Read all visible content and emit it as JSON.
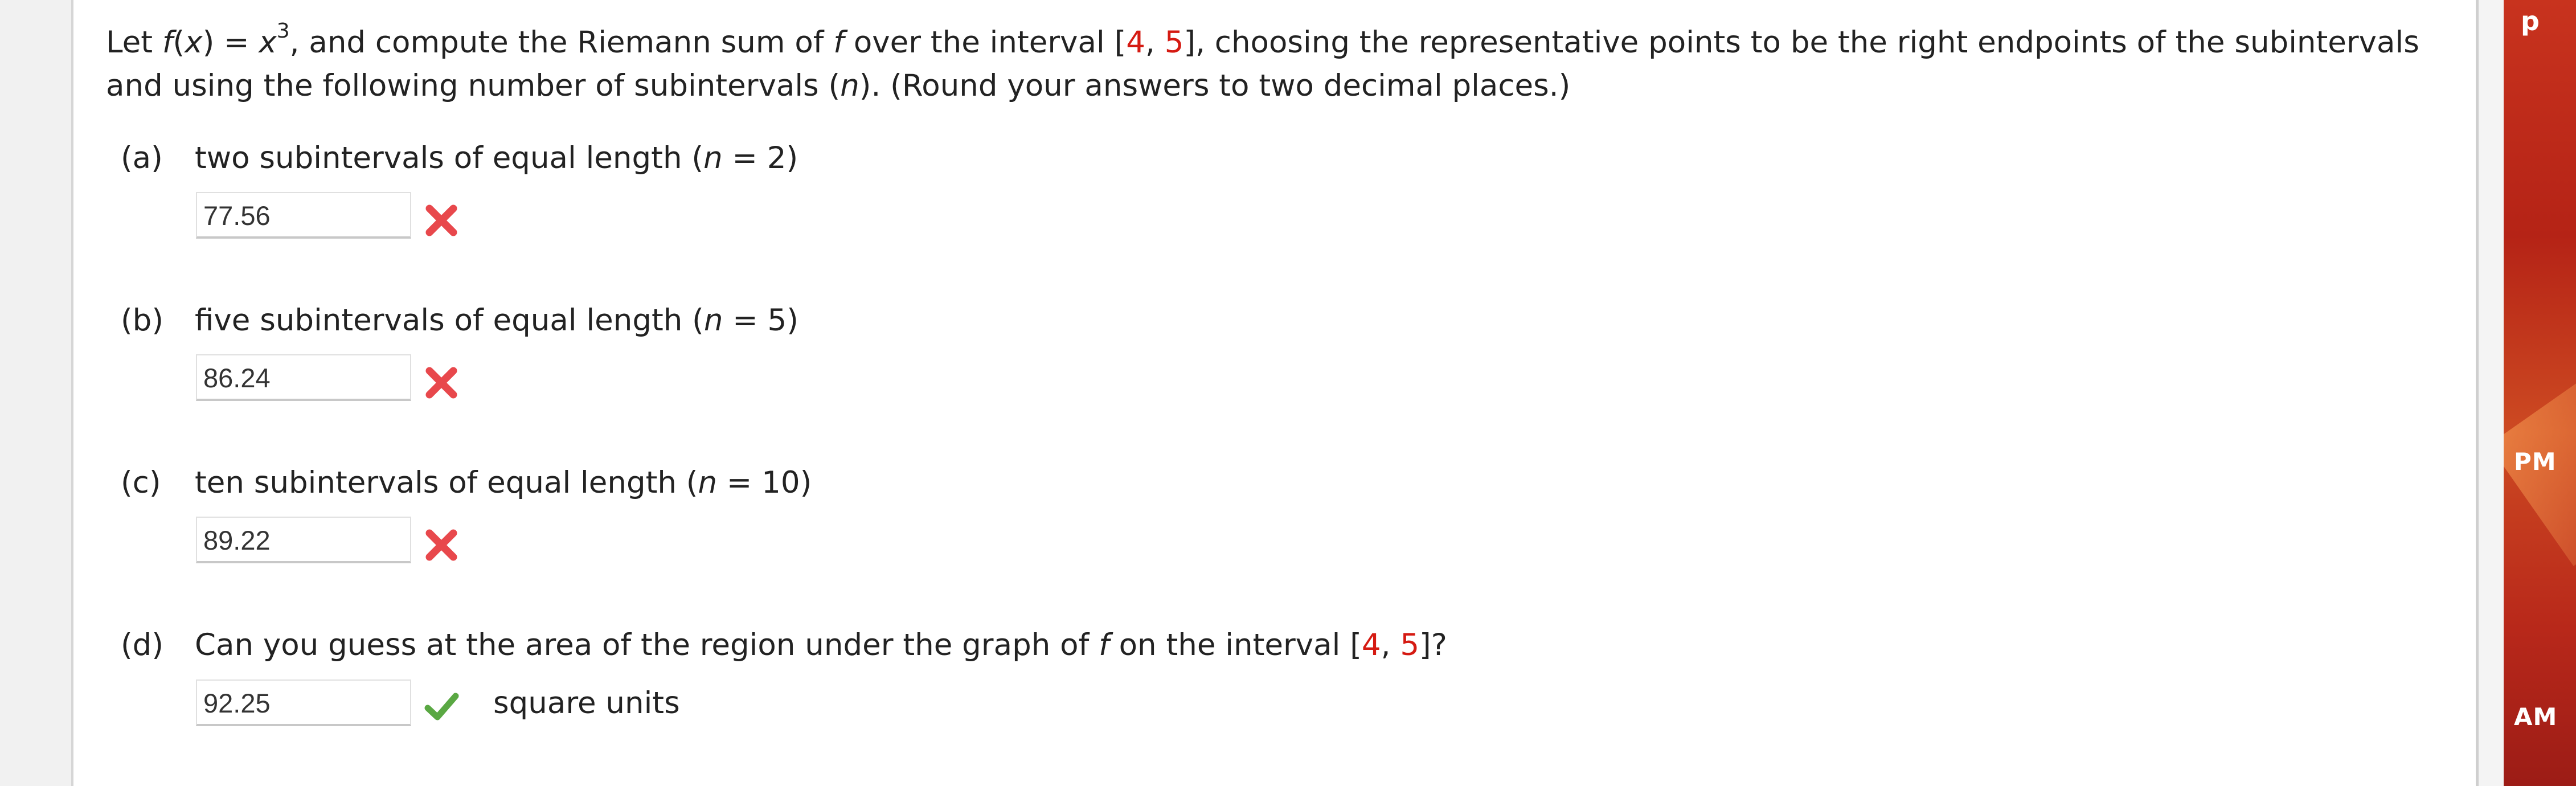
{
  "problem": {
    "intro_1": "Let ",
    "intro_f": "f",
    "intro_2": "(",
    "intro_x": "x",
    "intro_3": ") = ",
    "intro_x2": "x",
    "intro_exp": "3",
    "intro_4": ", and compute the Riemann sum of ",
    "intro_f2": "f",
    "intro_5": " over the interval [",
    "interval_a": "4",
    "intro_comma": ", ",
    "interval_b": "5",
    "intro_6": "], choosing the representative points to be the right endpoints of the subintervals and using the following number of subintervals (",
    "intro_n": "n",
    "intro_7": "). (Round your answers to two decimal places.)"
  },
  "parts": [
    {
      "label": "(a)",
      "text": "two subintervals of equal length (",
      "n_var": "n",
      "n_eq": " = 2)",
      "answer": "77.56",
      "status": "incorrect"
    },
    {
      "label": "(b)",
      "text": "five subintervals of equal length (",
      "n_var": "n",
      "n_eq": " = 5)",
      "answer": "86.24",
      "status": "incorrect"
    },
    {
      "label": "(c)",
      "text": "ten subintervals of equal length (",
      "n_var": "n",
      "n_eq": " = 10)",
      "answer": "89.22",
      "status": "incorrect"
    }
  ],
  "part_d": {
    "label": "(d)",
    "text_1": "Can you guess at the area of the region under the graph of ",
    "f": "f",
    "text_2": " on the interval [",
    "a": "4",
    "comma": ", ",
    "b": "5",
    "text_3": "]?",
    "answer": "92.25",
    "status": "correct",
    "units": "square units"
  },
  "desktop": {
    "label_top": "p",
    "label_mid": "PM",
    "label_bottom": "AM"
  },
  "colors": {
    "highlight": "#d51a12",
    "incorrect": "#e8484c",
    "correct": "#5aa843"
  }
}
